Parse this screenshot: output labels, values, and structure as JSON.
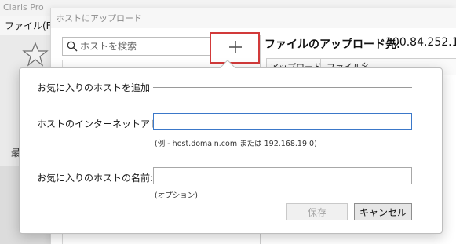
{
  "app": {
    "title": "Claris Pro"
  },
  "menu": {
    "file_label": "ファイル(F)"
  },
  "sidebar": {
    "partial_char": "最"
  },
  "upload_dialog": {
    "title": "ホストにアップロード",
    "search_placeholder": "ホストを検索",
    "destination_label": "ファイルのアップロード先:",
    "destination_value": "100.84.252.1",
    "columns": [
      "アップロード",
      "ファイル名"
    ]
  },
  "favorite_dialog": {
    "group_title": "お気に入りのホストを追加",
    "address_label": "ホストのインターネットアドレス",
    "address_value": "",
    "address_hint": "(例 - host.domain.com または 192.168.19.0)",
    "name_label": "お気に入りのホストの名前:",
    "name_value": "",
    "name_hint": "(オプション)",
    "save_label": "保存",
    "cancel_label": "キャンセル"
  },
  "colors": {
    "highlight_border": "#d23a3a",
    "focus_border": "#3b78c9"
  },
  "icons": {
    "search": "search-icon",
    "add": "plus-icon",
    "favorite": "star-icon"
  }
}
